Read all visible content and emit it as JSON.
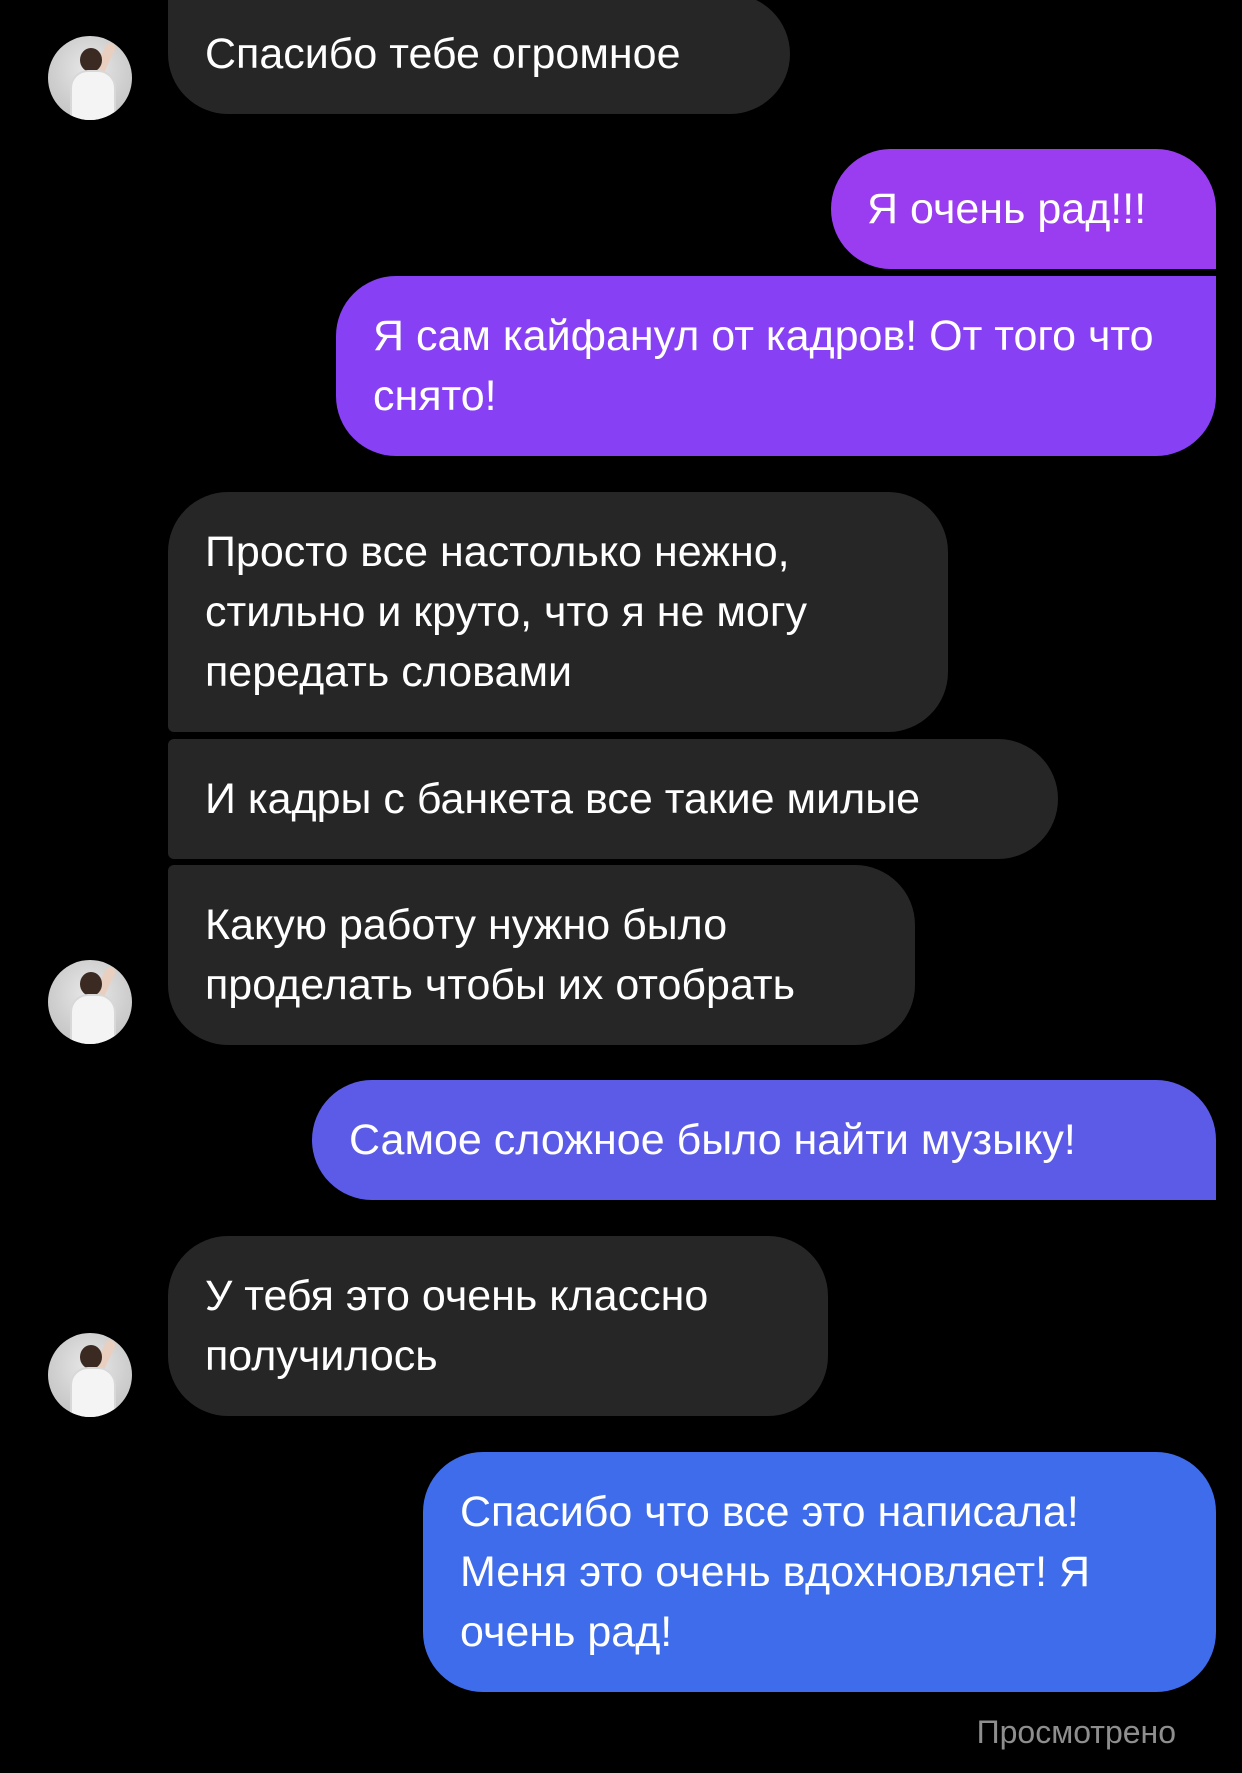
{
  "messages": [
    {
      "text": "Спасибо тебе огромное"
    },
    {
      "text": "Я очень рад!!!"
    },
    {
      "text": "Я сам кайфанул от кадров! От того что снято!"
    },
    {
      "text": "Просто все настолько нежно, стильно и круто, что я не могу передать словами"
    },
    {
      "text": "И кадры с банкета все такие милые"
    },
    {
      "text": "Какую работу нужно было проделать чтобы их отобрать"
    },
    {
      "text": "Самое сложное было найти музыку!"
    },
    {
      "text": "У тебя это очень классно получилось"
    },
    {
      "text": "Спасибо что все это написала! Меня это очень вдохновляет! Я очень рад!"
    }
  ],
  "status": {
    "seen": "Просмотрено"
  },
  "colors": {
    "incoming_bubble": "#262626",
    "outgoing_purple": "#8a3ff0",
    "outgoing_blue": "#3b6ef0",
    "background": "#000000",
    "seen_text": "#8e8e8e"
  }
}
